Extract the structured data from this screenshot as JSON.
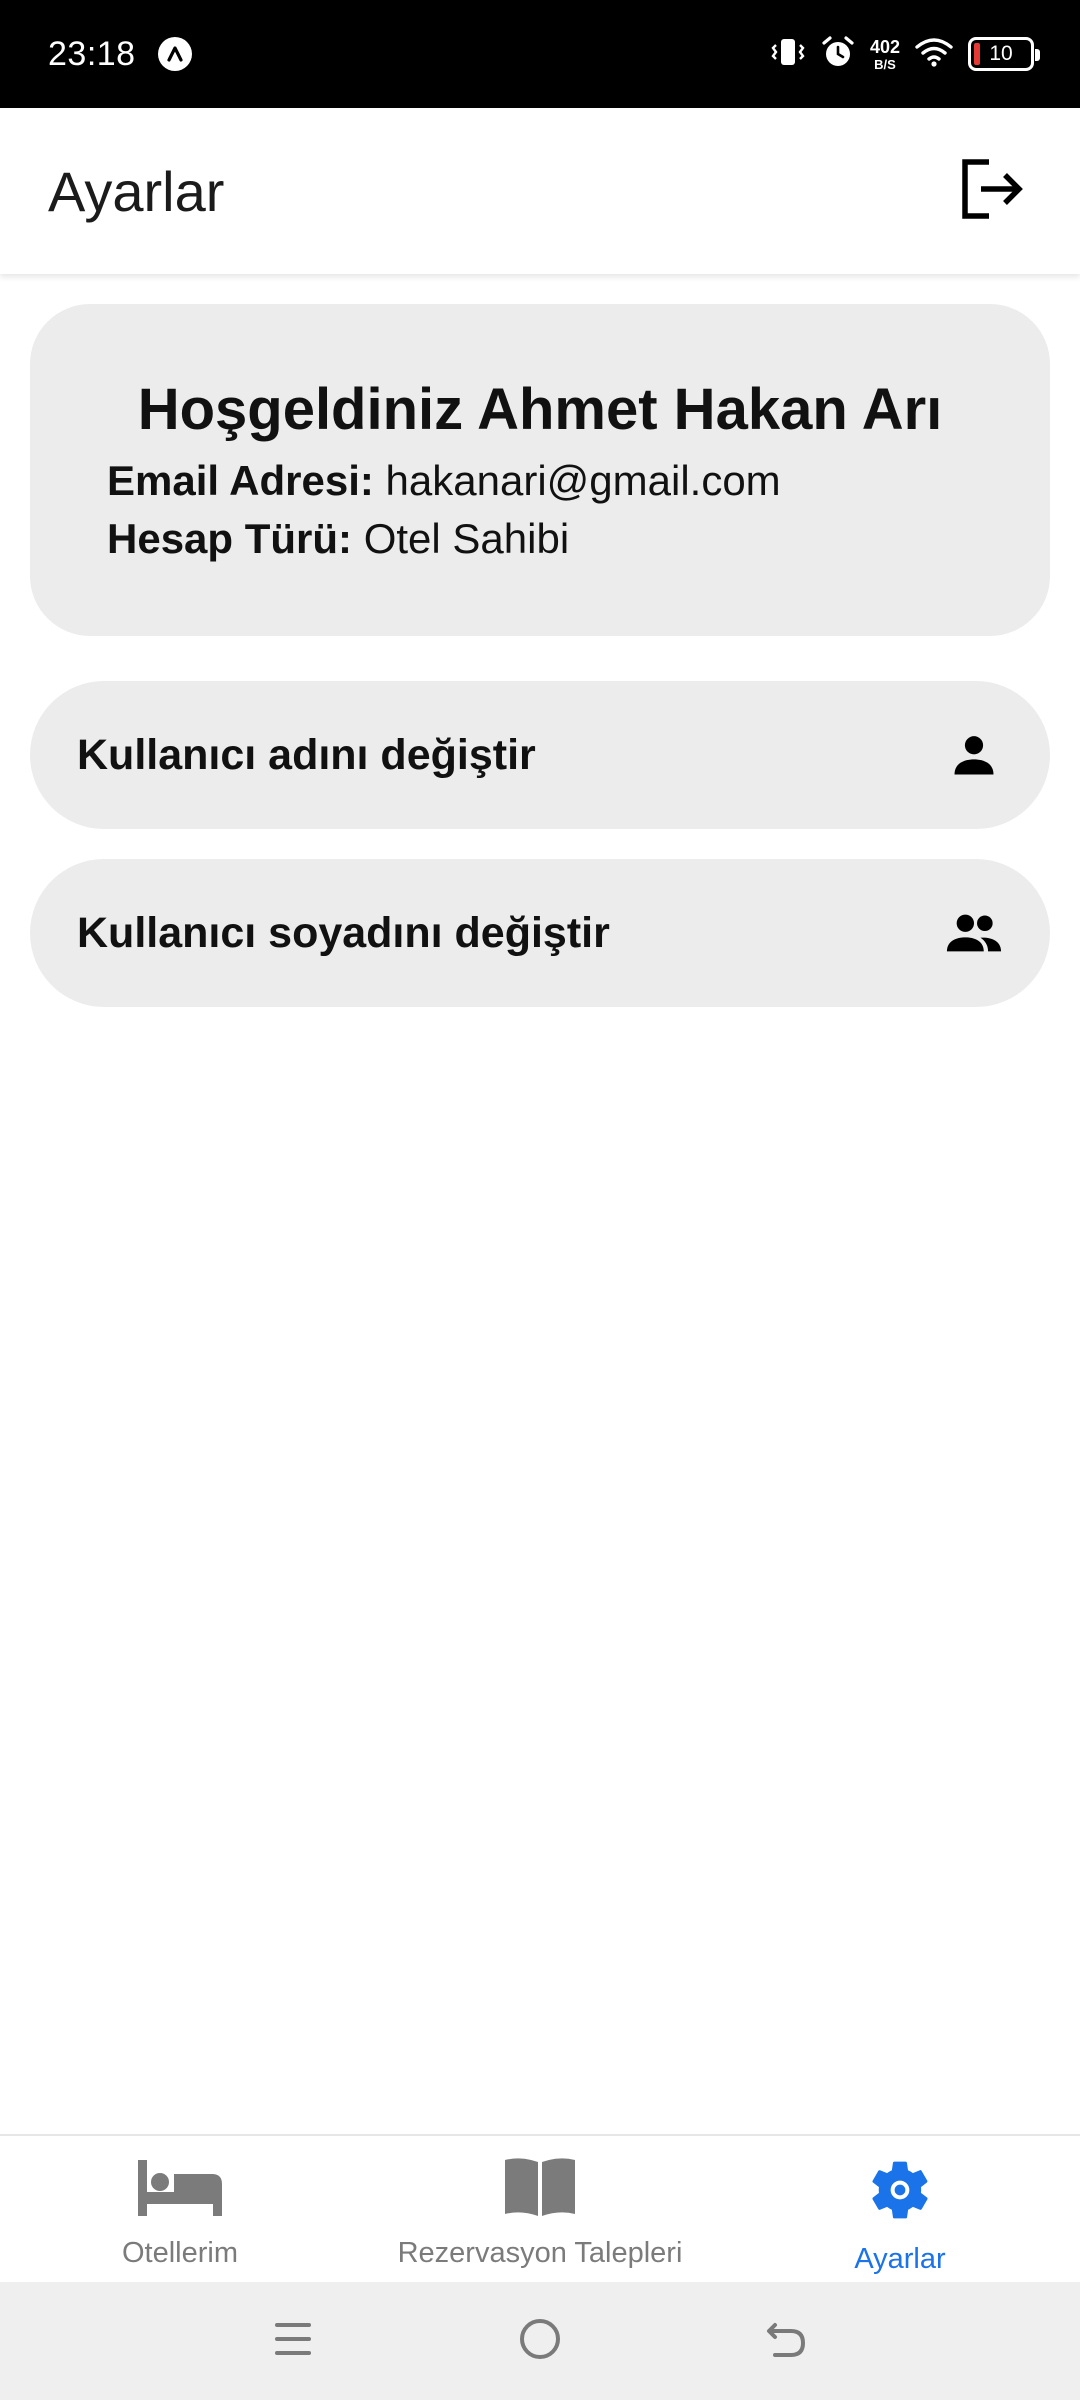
{
  "status_bar": {
    "time": "23:18",
    "speed_value": "402",
    "speed_unit": "B/S",
    "battery": "10",
    "icons": [
      "app-notification-icon",
      "vibrate-icon",
      "alarm-icon",
      "wifi-icon",
      "battery-icon"
    ]
  },
  "app_bar": {
    "title": "Ayarlar",
    "logout_icon": "logout-icon"
  },
  "welcome_card": {
    "title": "Hoşgeldiniz Ahmet Hakan Arı",
    "email_label": "Email Adresi:",
    "email_value": " hakanari@gmail.com",
    "account_type_label": "Hesap Türü:",
    "account_type_value": " Otel Sahibi"
  },
  "actions": [
    {
      "label": "Kullanıcı adını değiştir",
      "icon": "person-icon"
    },
    {
      "label": "Kullanıcı soyadını değiştir",
      "icon": "people-icon"
    }
  ],
  "bottom_nav": {
    "tabs": [
      {
        "label": "Otellerim",
        "icon": "bed-icon",
        "active": false
      },
      {
        "label": "Rezervasyon Talepleri",
        "icon": "book-icon",
        "active": false
      },
      {
        "label": "Ayarlar",
        "icon": "settings-icon",
        "active": true
      }
    ],
    "active_color": "#1a73e8",
    "inactive_color": "#7b7b7b"
  },
  "system_nav": {
    "buttons": [
      "menu-icon",
      "home-icon",
      "back-icon"
    ]
  }
}
